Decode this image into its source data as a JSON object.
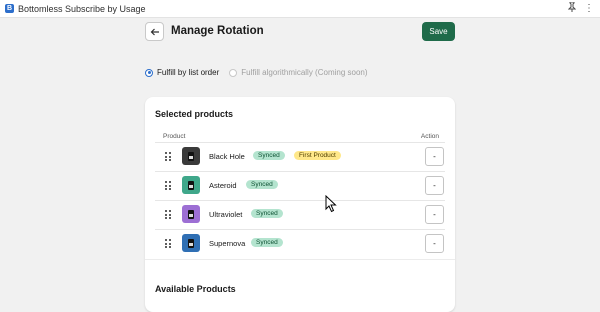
{
  "window": {
    "title": "Bottomless Subscribe by Usage",
    "app_icon_letter": "B",
    "pin_icon": "pin-icon",
    "more_icon": "more-icon"
  },
  "header": {
    "back_icon": "arrow-left-icon",
    "title": "Manage Rotation",
    "save_label": "Save",
    "save_color": "#1f6b4a"
  },
  "fulfillment": {
    "options": [
      {
        "label": "Fulfill by list order",
        "selected": true
      },
      {
        "label": "Fulfill algorithmically (Coming soon)",
        "selected": false
      }
    ]
  },
  "selected_products": {
    "title": "Selected products",
    "columns": {
      "product": "Product",
      "action": "Action"
    },
    "rows": [
      {
        "name": "Black Hole",
        "badges": [
          "Synced",
          "First Product"
        ],
        "thumb_color": "#3a3a3a",
        "action_label": "-"
      },
      {
        "name": "Asteroid",
        "badges": [
          "Synced"
        ],
        "thumb_color": "#3fa78a",
        "action_label": "-"
      },
      {
        "name": "Ultraviolet",
        "badges": [
          "Synced"
        ],
        "thumb_color": "#9d6fd4",
        "action_label": "-"
      },
      {
        "name": "Supernova",
        "badges": [
          "Synced"
        ],
        "thumb_color": "#2f6fb4",
        "action_label": "-"
      }
    ]
  },
  "available_products": {
    "title": "Available Products"
  }
}
